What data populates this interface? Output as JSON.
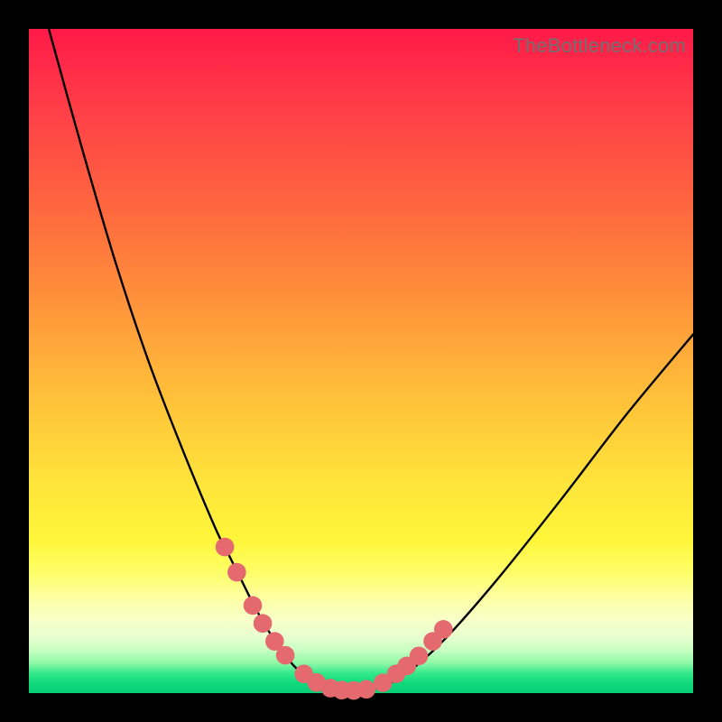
{
  "watermark": "TheBottleneck.com",
  "chart_data": {
    "type": "line",
    "title": "",
    "xlabel": "",
    "ylabel": "",
    "xlim": [
      0,
      100
    ],
    "ylim": [
      0,
      100
    ],
    "series": [
      {
        "name": "bottleneck-curve",
        "x": [
          3,
          8,
          13,
          18,
          23,
          28,
          30,
          32,
          34,
          36,
          38,
          40,
          42,
          44,
          46,
          48,
          50,
          52,
          56,
          62,
          70,
          80,
          90,
          100
        ],
        "y": [
          100,
          82,
          65,
          50,
          37,
          25,
          21,
          17,
          13,
          9.5,
          6.5,
          4,
          2.3,
          1.2,
          0.6,
          0.4,
          0.4,
          0.7,
          2.4,
          7.5,
          16.5,
          29,
          42,
          54
        ]
      }
    ],
    "markers": {
      "name": "highlight-dots",
      "color": "#e46a6f",
      "radius": 1.4,
      "x": [
        29.5,
        31.3,
        33.7,
        35.2,
        37.0,
        38.6,
        41.4,
        43.3,
        45.4,
        47.1,
        48.9,
        50.8,
        53.3,
        55.3,
        56.9,
        58.7,
        60.8,
        62.4
      ],
      "y": [
        22.0,
        18.2,
        13.2,
        10.5,
        7.8,
        5.7,
        2.9,
        1.6,
        0.75,
        0.45,
        0.4,
        0.58,
        1.55,
        2.9,
        4.1,
        5.6,
        7.8,
        9.6
      ]
    }
  }
}
